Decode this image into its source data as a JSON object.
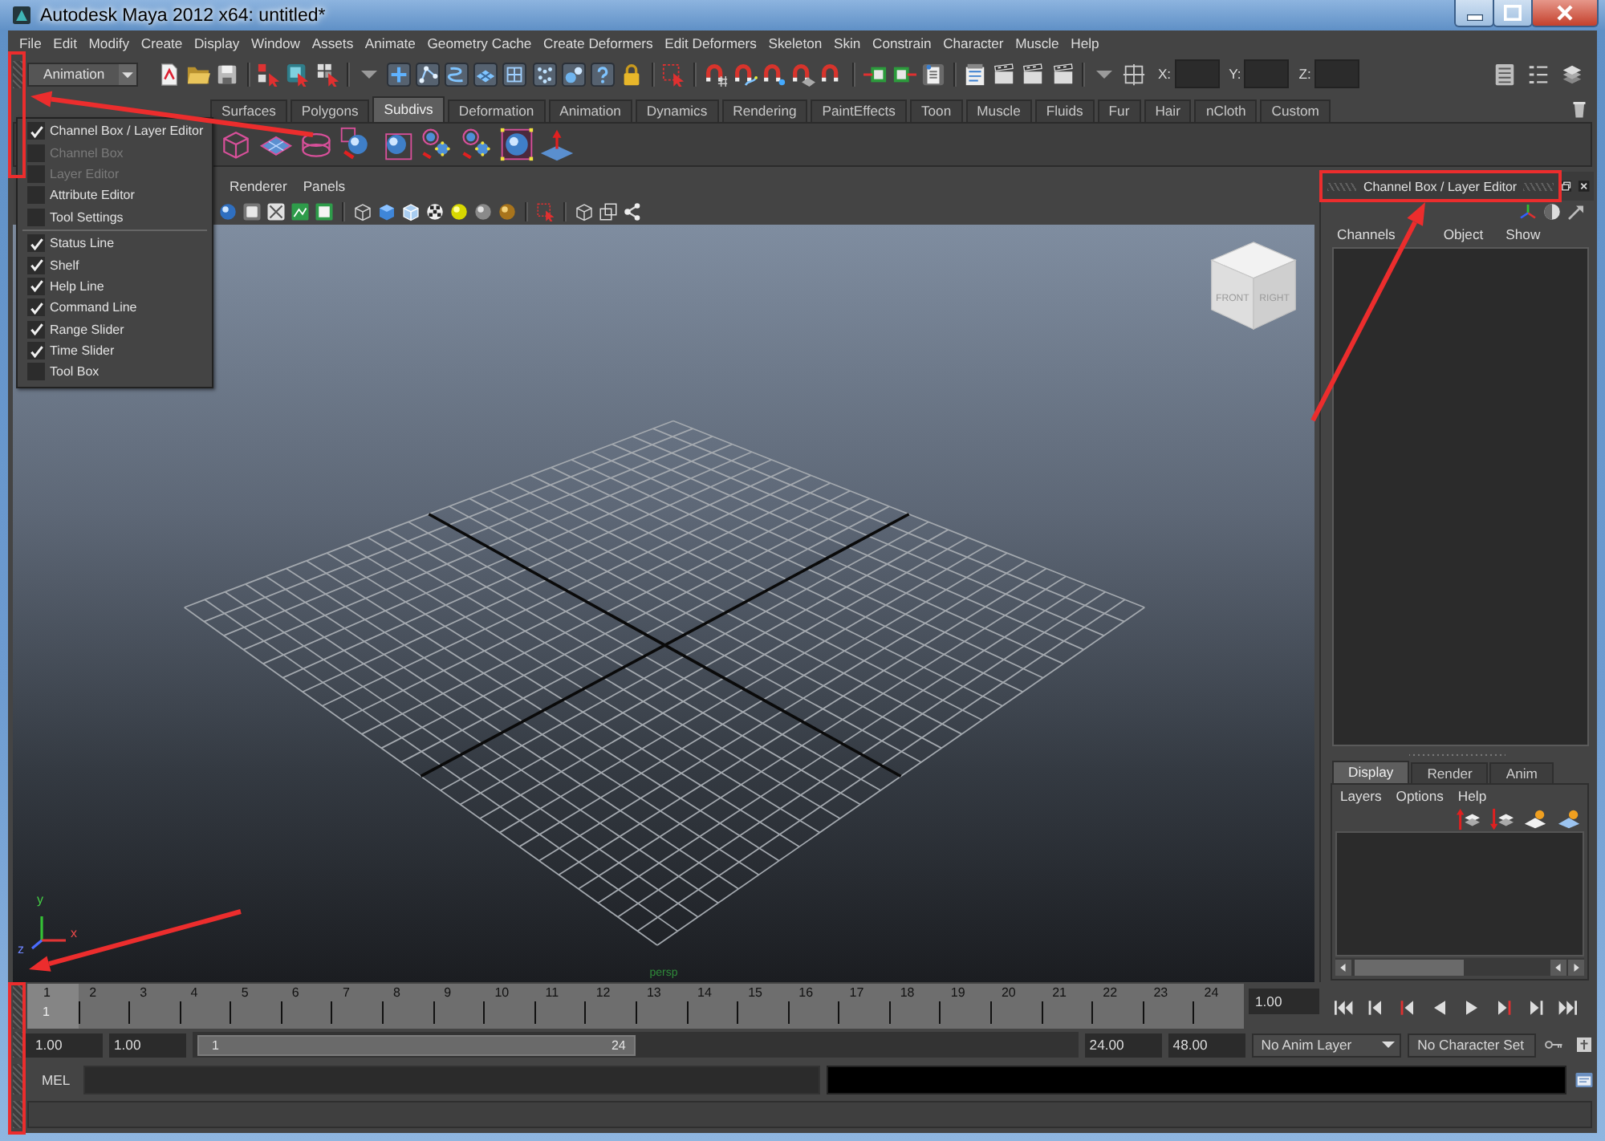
{
  "window": {
    "title": "Autodesk Maya 2012 x64: untitled*"
  },
  "menu_bar": [
    "File",
    "Edit",
    "Modify",
    "Create",
    "Display",
    "Window",
    "Assets",
    "Animate",
    "Geometry Cache",
    "Create Deformers",
    "Edit Deformers",
    "Skeleton",
    "Skin",
    "Constrain",
    "Character",
    "Muscle",
    "Help"
  ],
  "status_line": {
    "menu_set": "Animation",
    "coordinate_fields": [
      {
        "label": "X:"
      },
      {
        "label": "Y:"
      },
      {
        "label": "Z:"
      }
    ]
  },
  "shelf": {
    "tabs": [
      {
        "label": "Surfaces",
        "selected": false
      },
      {
        "label": "Polygons",
        "selected": false
      },
      {
        "label": "Subdivs",
        "selected": true
      },
      {
        "label": "Deformation",
        "selected": false
      },
      {
        "label": "Animation",
        "selected": false
      },
      {
        "label": "Dynamics",
        "selected": false
      },
      {
        "label": "Rendering",
        "selected": false
      },
      {
        "label": "PaintEffects",
        "selected": false
      },
      {
        "label": "Toon",
        "selected": false
      },
      {
        "label": "Muscle",
        "selected": false
      },
      {
        "label": "Fluids",
        "selected": false
      },
      {
        "label": "Fur",
        "selected": false
      },
      {
        "label": "Hair",
        "selected": false
      },
      {
        "label": "nCloth",
        "selected": false
      },
      {
        "label": "Custom",
        "selected": false
      }
    ]
  },
  "ui_elements_menu": {
    "items": [
      {
        "kind": "toggle",
        "label": "Channel Box / Layer Editor",
        "checked": true,
        "disabled": false
      },
      {
        "kind": "toggle",
        "label": "Channel Box",
        "checked": false,
        "disabled": true
      },
      {
        "kind": "toggle",
        "label": "Layer Editor",
        "checked": false,
        "disabled": true
      },
      {
        "kind": "toggle",
        "label": "Attribute Editor",
        "checked": false,
        "disabled": false
      },
      {
        "kind": "toggle",
        "label": "Tool Settings",
        "checked": false,
        "disabled": false
      },
      {
        "kind": "separator"
      },
      {
        "kind": "toggle",
        "label": "Status Line",
        "checked": true,
        "disabled": false
      },
      {
        "kind": "toggle",
        "label": "Shelf",
        "checked": true,
        "disabled": false
      },
      {
        "kind": "toggle",
        "label": "Help Line",
        "checked": true,
        "disabled": false
      },
      {
        "kind": "toggle",
        "label": "Command Line",
        "checked": true,
        "disabled": false
      },
      {
        "kind": "toggle",
        "label": "Range Slider",
        "checked": true,
        "disabled": false
      },
      {
        "kind": "toggle",
        "label": "Time Slider",
        "checked": true,
        "disabled": false
      },
      {
        "kind": "toggle",
        "label": "Tool Box",
        "checked": false,
        "disabled": false
      }
    ]
  },
  "panel_menu": [
    "Renderer",
    "Panels"
  ],
  "viewport": {
    "camera": "persp",
    "view_cube_faces": [
      "FRONT",
      "RIGHT"
    ],
    "axis_labels": [
      "y",
      "z",
      "x"
    ]
  },
  "channel_box": {
    "title": "Channel Box / Layer Editor",
    "menu": [
      "Channels",
      "Object",
      "Show"
    ],
    "layer_tabs": [
      {
        "label": "Display",
        "selected": true
      },
      {
        "label": "Render",
        "selected": false
      },
      {
        "label": "Anim",
        "selected": false
      }
    ],
    "layer_menu": [
      "Layers",
      "Options",
      "Help"
    ]
  },
  "time_slider": {
    "frames": [
      {
        "label": "1",
        "selected": true
      },
      {
        "label": "2",
        "selected": false
      },
      {
        "label": "3",
        "selected": false
      },
      {
        "label": "4",
        "selected": false
      },
      {
        "label": "5",
        "selected": false
      },
      {
        "label": "6",
        "selected": false
      },
      {
        "label": "7",
        "selected": false
      },
      {
        "label": "8",
        "selected": false
      },
      {
        "label": "9",
        "selected": false
      },
      {
        "label": "10",
        "selected": false
      },
      {
        "label": "11",
        "selected": false
      },
      {
        "label": "12",
        "selected": false
      },
      {
        "label": "13",
        "selected": false
      },
      {
        "label": "14",
        "selected": false
      },
      {
        "label": "15",
        "selected": false
      },
      {
        "label": "16",
        "selected": false
      },
      {
        "label": "17",
        "selected": false
      },
      {
        "label": "18",
        "selected": false
      },
      {
        "label": "19",
        "selected": false
      },
      {
        "label": "20",
        "selected": false
      },
      {
        "label": "21",
        "selected": false
      },
      {
        "label": "22",
        "selected": false
      },
      {
        "label": "23",
        "selected": false
      },
      {
        "label": "24",
        "selected": false
      }
    ],
    "current_frame": "1",
    "current_time": "1.00"
  },
  "range_slider": {
    "start_time": "1.00",
    "playback_start": "1.00",
    "range_start": "1",
    "range_end": "24",
    "playback_end": "24.00",
    "end_time": "48.00",
    "anim_layer": "No Anim Layer",
    "character_set": "No Character Set"
  },
  "command_line": {
    "language": "MEL"
  }
}
